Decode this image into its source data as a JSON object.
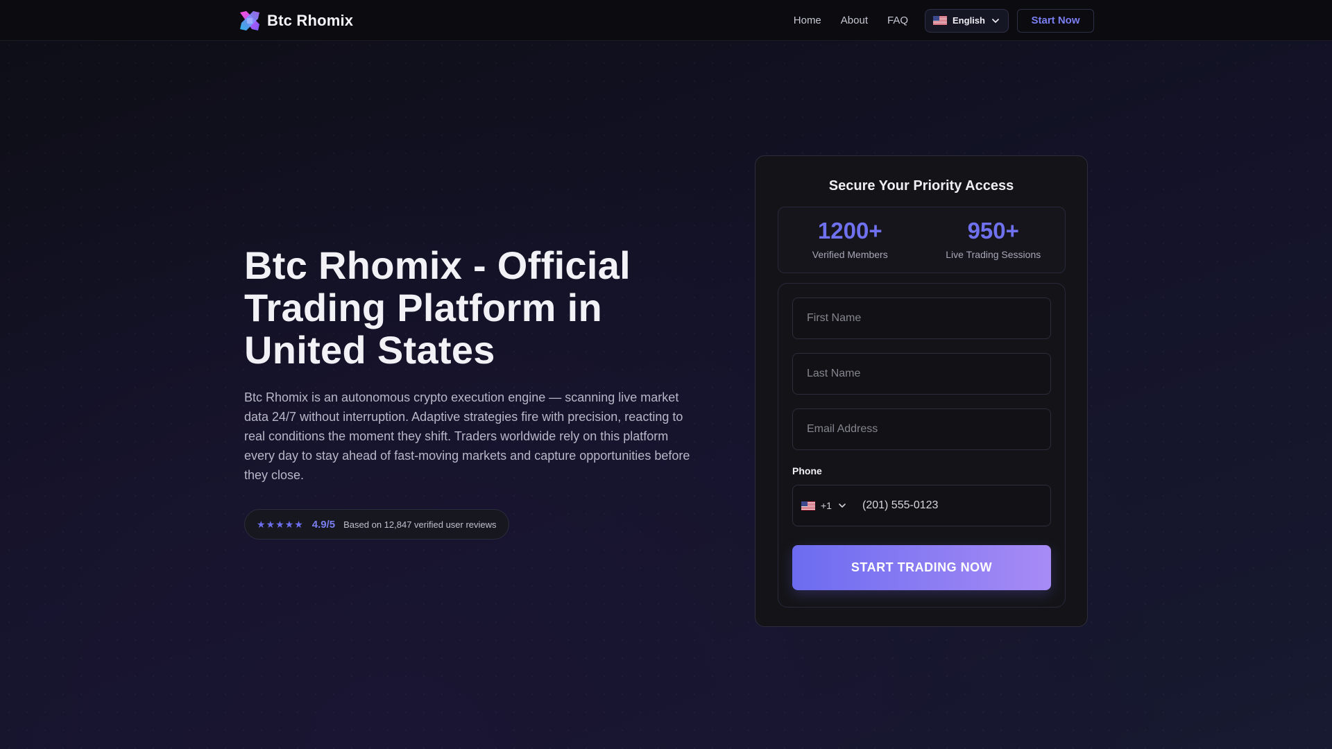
{
  "brand": {
    "name": "Btc Rhomix"
  },
  "nav": {
    "links": [
      "Home",
      "About",
      "FAQ"
    ],
    "language": "English",
    "start_now": "Start Now"
  },
  "hero": {
    "title": "Btc Rhomix - Official Trading Platform in United States",
    "description": "Btc Rhomix is an autonomous crypto execution engine — scanning live market data 24/7 without interruption. Adaptive strategies fire with precision, reacting to real conditions the moment they shift. Traders worldwide rely on this platform every day to stay ahead of fast-moving markets and capture opportunities before they close.",
    "rating": {
      "stars": "★★★★★",
      "score": "4.9/5",
      "reviews": "Based on 12,847 verified user reviews"
    }
  },
  "card": {
    "title": "Secure Your Priority Access",
    "stats": [
      {
        "value": "1200+",
        "label": "Verified Members"
      },
      {
        "value": "950+",
        "label": "Live Trading Sessions"
      }
    ],
    "form": {
      "first_name_placeholder": "First Name",
      "last_name_placeholder": "Last Name",
      "email_placeholder": "Email Address",
      "phone_label": "Phone",
      "country_code": "+1",
      "phone_placeholder": "(201) 555-0123",
      "submit": "START TRADING NOW"
    }
  },
  "colors": {
    "accent": "#6f71ee",
    "cta_start": "#6c6cf0",
    "cta_end": "#a78bf5",
    "background": "#0f0f1a"
  },
  "icons": {
    "logo": "brand-logo-icon",
    "flag": "us-flag-icon",
    "chevron": "chevron-down-icon"
  }
}
